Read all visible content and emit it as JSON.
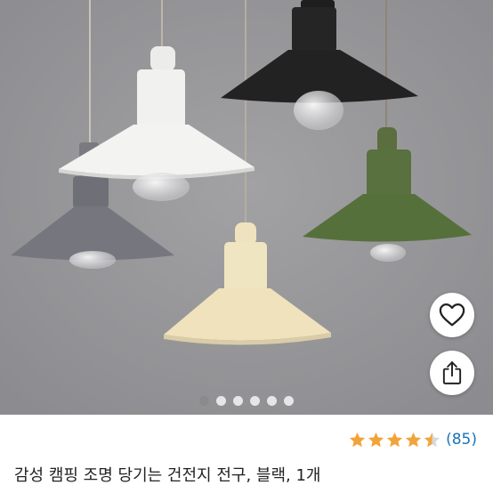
{
  "product": {
    "title": "감성 캠핑 조명 당기는 건전지 전구, 블랙, 1개",
    "rating_value": 4.5,
    "rating_count_text": "(85)"
  },
  "gallery": {
    "total_images": 6,
    "active_index": 0
  },
  "actions": {
    "like_icon": "heart-outline-icon",
    "share_icon": "share-icon"
  },
  "colors": {
    "star": "#f2a33a",
    "rating_count": "#1a73b7",
    "backdrop": "#97979a"
  }
}
